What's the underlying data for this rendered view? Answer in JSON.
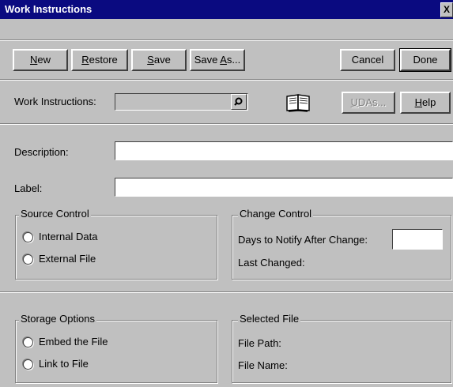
{
  "window": {
    "title": "Work Instructions",
    "close_glyph": "X"
  },
  "toolbar": {
    "new_pre": "",
    "new_u": "N",
    "new_post": "ew",
    "restore_pre": "",
    "restore_u": "R",
    "restore_post": "estore",
    "save_pre": "",
    "save_u": "S",
    "save_post": "ave",
    "saveas_pre": "Save ",
    "saveas_u": "A",
    "saveas_post": "s...",
    "cancel_label": "Cancel",
    "done_label": "Done"
  },
  "header": {
    "work_instructions_label": "Work Instructions:",
    "work_instructions_value": "",
    "udas_pre": "",
    "udas_u": "U",
    "udas_post": "DAs...",
    "help_pre": "",
    "help_u": "H",
    "help_post": "elp",
    "icons": [
      "search-icon",
      "book-icon"
    ]
  },
  "form": {
    "description_label": "Description:",
    "description_value": "",
    "label_label": "Label:",
    "label_value": ""
  },
  "source_control": {
    "title": "Source Control",
    "options": [
      "Internal Data",
      "External File"
    ]
  },
  "change_control": {
    "title": "Change Control",
    "days_label": "Days to Notify After Change:",
    "days_value": "",
    "last_changed_label": "Last Changed:"
  },
  "storage_options": {
    "title": "Storage Options",
    "options": [
      "Embed the File",
      "Link to File"
    ]
  },
  "selected_file": {
    "title": "Selected File",
    "path_label": "File Path:",
    "name_label": "File Name:"
  },
  "colors": {
    "titlebar": "#0a0a80",
    "face": "#c0c0c0"
  }
}
